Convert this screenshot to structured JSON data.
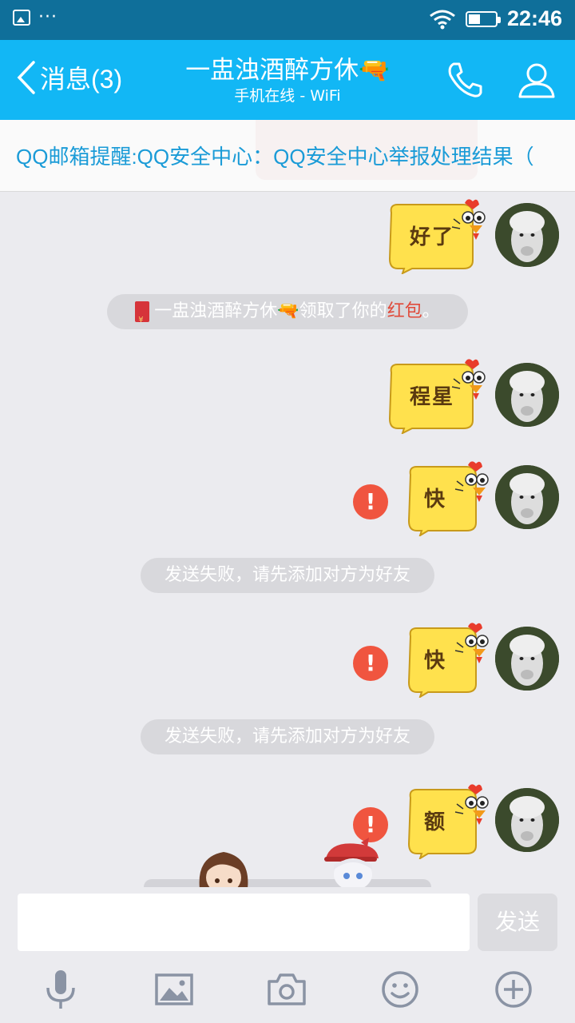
{
  "status_bar": {
    "time": "22:46",
    "dots": "···"
  },
  "header": {
    "back_label": "消息(3)",
    "contact_name": "一盅浊酒醉方休🔫",
    "contact_status": "手机在线 - WiFi"
  },
  "notice": {
    "text": "QQ邮箱提醒:QQ安全中心：QQ安全中心举报处理结果（"
  },
  "messages": [
    {
      "sticker_text": "好了"
    },
    {
      "system_prefix": "一盅浊酒醉方休🔫领取了你的",
      "system_highlight": "红包",
      "system_suffix": "。"
    },
    {
      "sticker_text": "程星"
    },
    {
      "sticker_text": "快",
      "failed": true,
      "fail_mark": "!"
    },
    {
      "system_text": "发送失败，请先添加对方为好友"
    },
    {
      "sticker_text": "快",
      "failed": true,
      "fail_mark": "!"
    },
    {
      "system_text": "发送失败，请先添加对方为好友"
    },
    {
      "sticker_text": "额",
      "failed": true,
      "fail_mark": "!"
    }
  ],
  "input": {
    "value": "",
    "placeholder": "",
    "send_label": "发送"
  },
  "toolbar": [
    "microphone-icon",
    "image-icon",
    "camera-icon",
    "emoji-icon",
    "plus-icon"
  ],
  "colors": {
    "status_bar": "#0f6f9a",
    "title_bar": "#12b7f5",
    "notice_text": "#1a9bd7",
    "fail_red": "#f0553f",
    "sticker_yellow": "#ffe14d"
  }
}
